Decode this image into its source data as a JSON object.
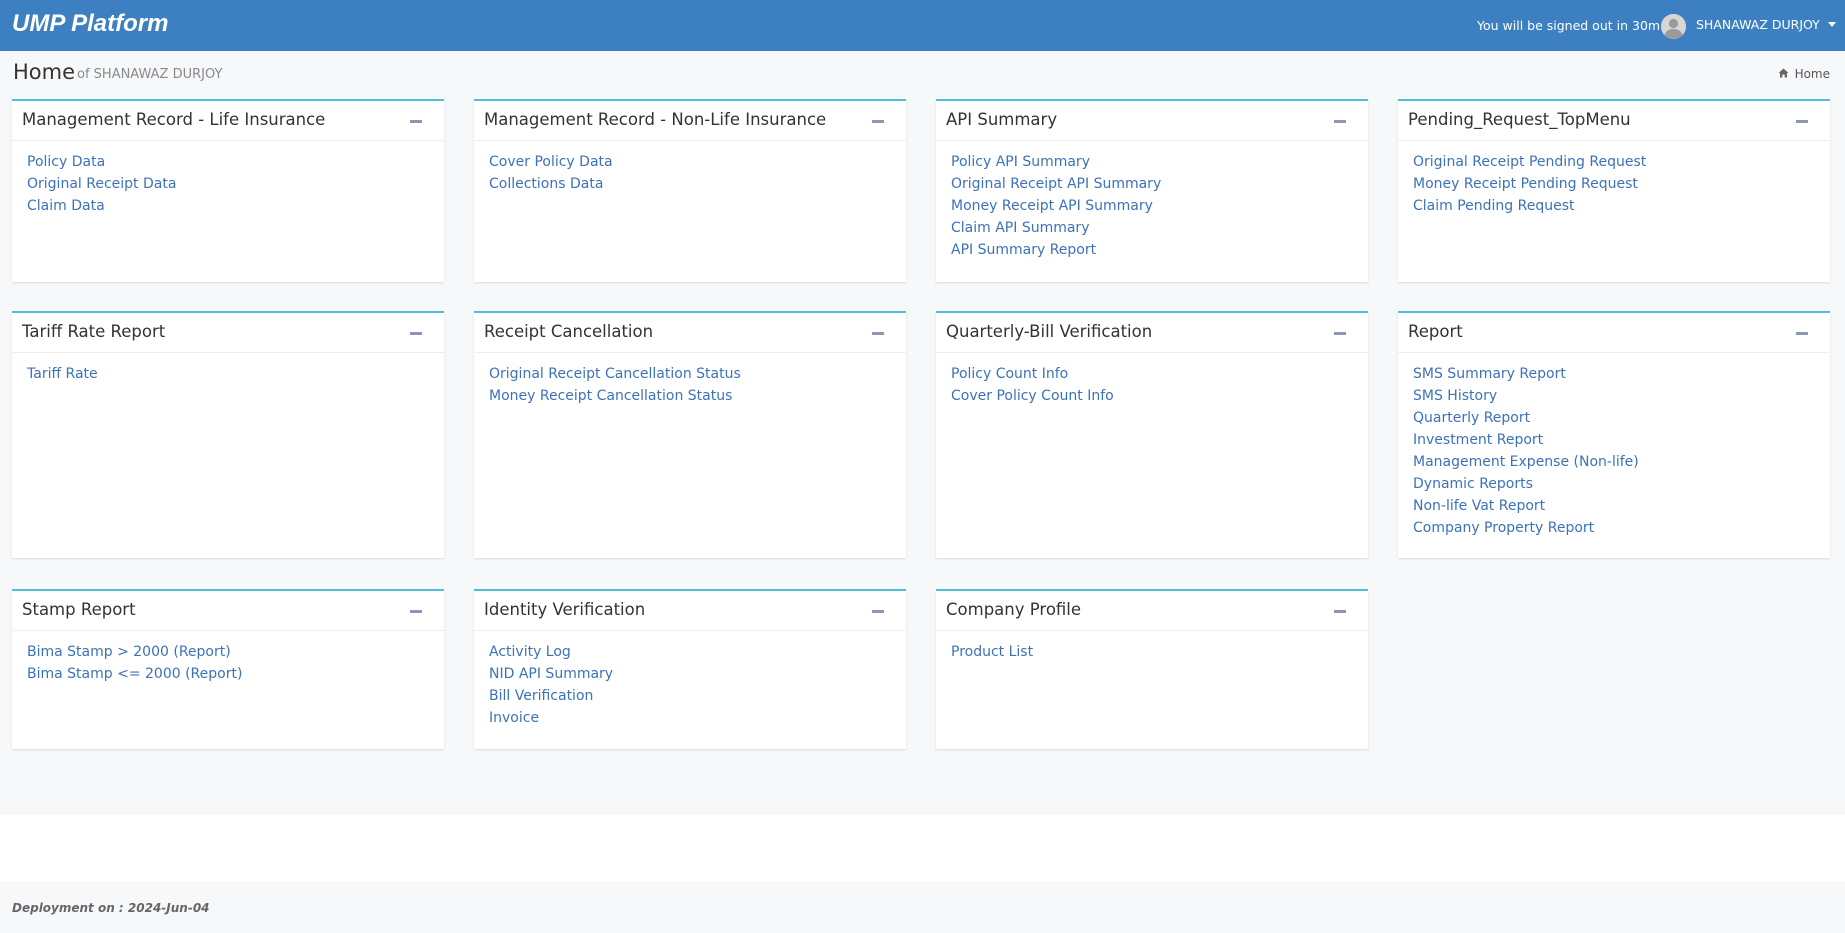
{
  "header": {
    "brand": "UMP Platform",
    "signout_notice": "You will be signed out in 30m",
    "user_name": "SHANAWAZ DURJOY",
    "avatar_icon": "user-avatar-icon",
    "caret_icon": "caret-down-icon"
  },
  "page": {
    "title": "Home",
    "subtitle": "of SHANAWAZ DURJOY",
    "breadcrumb": "Home",
    "breadcrumb_icon": "home-icon"
  },
  "boxes": [
    {
      "title": "Management Record - Life Insurance",
      "links": [
        "Policy Data",
        "Original Receipt Data",
        "Claim Data"
      ]
    },
    {
      "title": "Management Record - Non-Life Insurance",
      "links": [
        "Cover Policy Data",
        "Collections Data"
      ]
    },
    {
      "title": "API Summary",
      "links": [
        "Policy API Summary",
        "Original Receipt API Summary",
        "Money Receipt API Summary",
        "Claim API Summary",
        "API Summary Report"
      ]
    },
    {
      "title": "Pending_Request_TopMenu",
      "links": [
        "Original Receipt Pending Request",
        "Money Receipt Pending Request",
        "Claim Pending Request"
      ]
    },
    {
      "title": "Tariff Rate Report",
      "links": [
        "Tariff Rate"
      ]
    },
    {
      "title": "Receipt Cancellation",
      "links": [
        "Original Receipt Cancellation Status",
        "Money Receipt Cancellation Status"
      ]
    },
    {
      "title": "Quarterly-Bill Verification",
      "links": [
        "Policy Count Info",
        "Cover Policy Count Info"
      ]
    },
    {
      "title": "Report",
      "links": [
        "SMS Summary Report",
        "SMS History",
        "Quarterly Report",
        "Investment Report",
        "Management Expense (Non-life)",
        "Dynamic Reports",
        "Non-life Vat Report",
        "Company Property Report"
      ]
    },
    {
      "title": "Stamp Report",
      "links": [
        "Bima Stamp > 2000 (Report)",
        "Bima Stamp <= 2000 (Report)"
      ]
    },
    {
      "title": "Identity Verification",
      "links": [
        "Activity Log",
        "NID API Summary",
        "Bill Verification",
        "Invoice"
      ]
    },
    {
      "title": "Company Profile",
      "links": [
        "Product List"
      ]
    }
  ],
  "footer": {
    "deployment": "Deployment on : 2024-Jun-04"
  },
  "colors": {
    "header_bg": "#3c80c1",
    "box_accent": "#4bc0d6",
    "link": "#3c72b8",
    "content_bg": "#f7f8fa"
  }
}
